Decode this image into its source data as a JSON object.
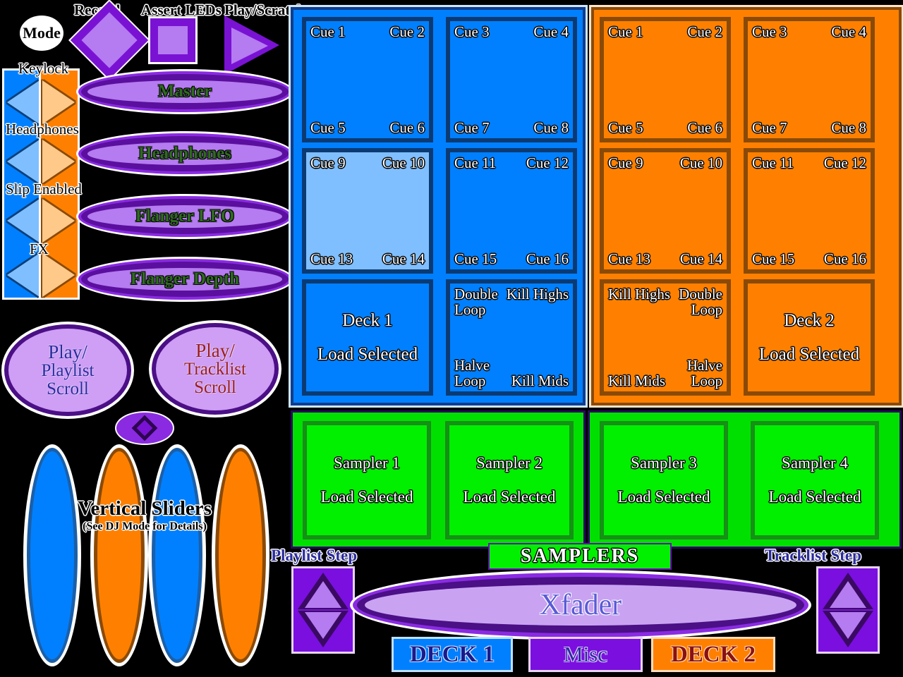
{
  "left_panel": {
    "mode_label": "Mode",
    "top_icons": [
      {
        "label": "Record",
        "icon": "diamond-icon"
      },
      {
        "label": "Assert LEDs",
        "icon": "square-icon"
      },
      {
        "label": "Play/Scratch",
        "icon": "play-triangle-icon"
      }
    ],
    "toggles": [
      {
        "label": "Keylock"
      },
      {
        "label": "Headphones"
      },
      {
        "label": "Slip Enabled"
      },
      {
        "label": "FX"
      }
    ],
    "knobs": [
      {
        "label": "Master"
      },
      {
        "label": "Headphones"
      },
      {
        "label": "Flanger LFO"
      },
      {
        "label": "Flanger Depth"
      }
    ],
    "scroll_buttons": [
      {
        "line1": "Play/",
        "line2": "Playlist",
        "line3": "Scroll"
      },
      {
        "line1": "Play/",
        "line2": "Tracklist",
        "line3": "Scroll"
      }
    ],
    "sliders_title": "Vertical Sliders",
    "sliders_subtitle": "(See DJ Mode for Details)"
  },
  "deck1": {
    "pads": [
      {
        "tl": "Cue 1",
        "tr": "Cue 2",
        "bl": "Cue 5",
        "br": "Cue 6",
        "highlight": false
      },
      {
        "tl": "Cue 3",
        "tr": "Cue 4",
        "bl": "Cue 7",
        "br": "Cue 8",
        "highlight": false
      },
      {
        "tl": "Cue 9",
        "tr": "Cue 10",
        "bl": "Cue 13",
        "br": "Cue 14",
        "highlight": true
      },
      {
        "tl": "Cue 11",
        "tr": "Cue 12",
        "bl": "Cue 15",
        "br": "Cue 16",
        "highlight": false
      }
    ],
    "load_pad": {
      "line1": "Deck 1",
      "line2": "Load Selected"
    },
    "fx_pad": {
      "tl": "Double\nLoop",
      "tr": "Kill Highs",
      "bl": "Halve\nLoop",
      "br": "Kill Mids"
    }
  },
  "deck2": {
    "pads": [
      {
        "tl": "Cue 1",
        "tr": "Cue 2",
        "bl": "Cue 5",
        "br": "Cue 6"
      },
      {
        "tl": "Cue 3",
        "tr": "Cue 4",
        "bl": "Cue 7",
        "br": "Cue 8"
      },
      {
        "tl": "Cue 9",
        "tr": "Cue 10",
        "bl": "Cue 13",
        "br": "Cue 14"
      },
      {
        "tl": "Cue 11",
        "tr": "Cue 12",
        "bl": "Cue 15",
        "br": "Cue 16"
      }
    ],
    "fx_pad": {
      "tl": "Kill Highs",
      "tr": "Double\nLoop",
      "bl": "Kill Mids",
      "br": "Halve\nLoop"
    },
    "load_pad": {
      "line1": "Deck 2",
      "line2": "Load Selected"
    }
  },
  "samplers": {
    "badge": "SAMPLERS",
    "pads": [
      {
        "line1": "Sampler 1",
        "line2": "Load Selected"
      },
      {
        "line1": "Sampler 2",
        "line2": "Load Selected"
      },
      {
        "line1": "Sampler 3",
        "line2": "Load Selected"
      },
      {
        "line1": "Sampler 4",
        "line2": "Load Selected"
      }
    ]
  },
  "bottom": {
    "playlist_step": "Playlist Step",
    "tracklist_step": "Tracklist Step",
    "xfader": "Xfader",
    "tabs": [
      {
        "label": "DECK 1"
      },
      {
        "label": "Misc"
      },
      {
        "label": "DECK 2"
      }
    ]
  },
  "colors": {
    "deck1_blue": "#0080ff",
    "deck1_blue_highlight": "#7fbfff",
    "deck2_orange": "#ff8000",
    "sampler_green": "#00f000",
    "misc_purple": "#7a0fe0",
    "knob_lavender": "#b57bf0"
  }
}
